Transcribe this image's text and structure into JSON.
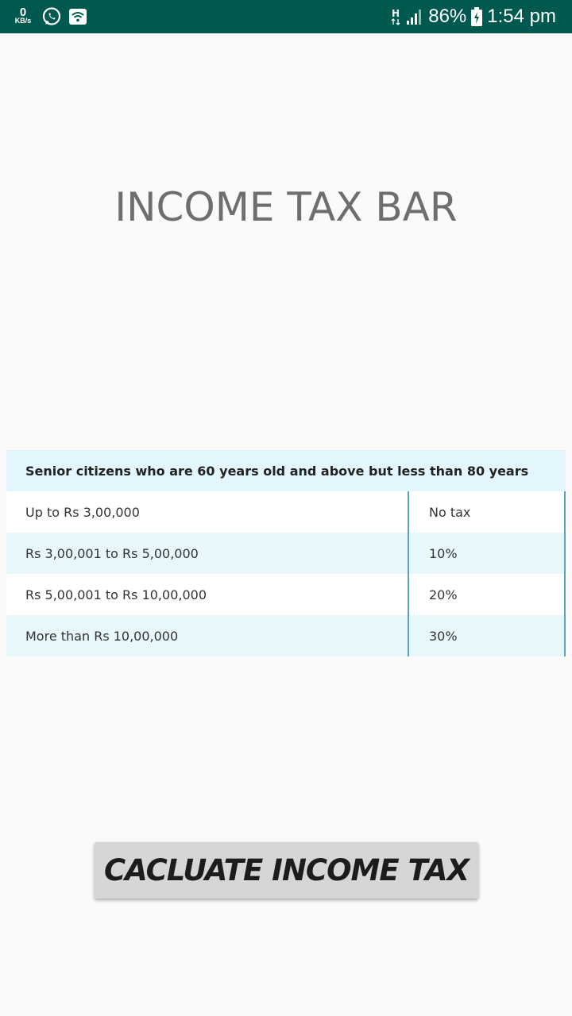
{
  "status_bar": {
    "net_speed_value": "0",
    "net_speed_unit": "KB/s",
    "network_type": "H",
    "battery_percent": "86%",
    "time": "1:54 pm"
  },
  "app": {
    "title": "INCOME TAX BAR"
  },
  "tax_table": {
    "header": "Senior citizens who are 60 years old and above but less than 80 years",
    "rows": [
      {
        "income": "Up to Rs 3,00,000",
        "rate": "No tax"
      },
      {
        "income": "Rs 3,00,001 to Rs 5,00,000",
        "rate": "10%"
      },
      {
        "income": "Rs 5,00,001 to Rs 10,00,000",
        "rate": "20%"
      },
      {
        "income": "More than Rs 10,00,000",
        "rate": "30%"
      }
    ]
  },
  "actions": {
    "calculate_label": "CACLUATE INCOME TAX"
  },
  "colors": {
    "status_bar": "#00594f",
    "background": "#fafafa",
    "table_alt_row": "#e8f7fc",
    "table_divider": "#5aa2c4",
    "button": "#d6d6d6"
  }
}
